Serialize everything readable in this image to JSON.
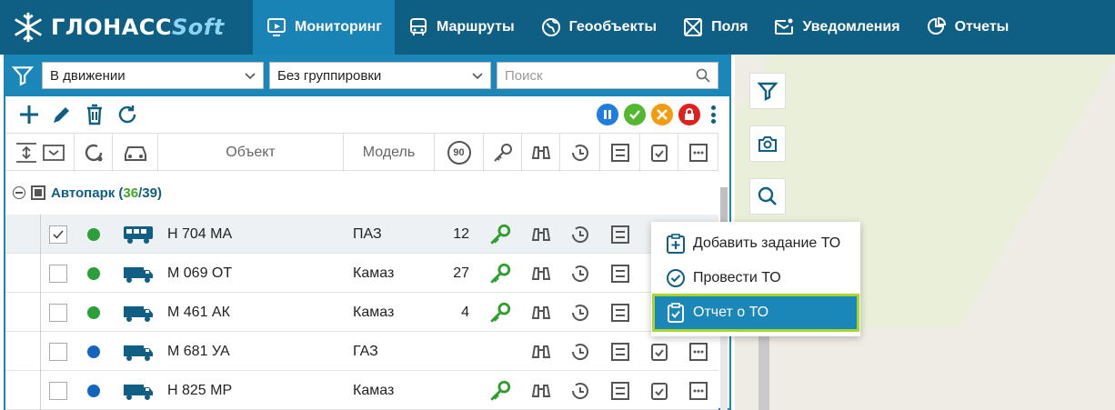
{
  "brand": {
    "name_main": "ГЛОНАСС",
    "name_soft": "Soft"
  },
  "nav": {
    "tabs": [
      {
        "label": "Мониторинг",
        "icon": "monitor-icon",
        "active": true
      },
      {
        "label": "Маршруты",
        "icon": "bus-icon"
      },
      {
        "label": "Геообъекты",
        "icon": "globe-icon"
      },
      {
        "label": "Поля",
        "icon": "field-icon"
      },
      {
        "label": "Уведомления",
        "icon": "mail-icon"
      },
      {
        "label": "Отчеты",
        "icon": "report-icon"
      }
    ]
  },
  "filters": {
    "status_value": "В движении",
    "group_value": "Без группировки",
    "search_placeholder": "Поиск"
  },
  "columns": {
    "object": "Объект",
    "model": "Модель",
    "speed_badge": "90"
  },
  "group": {
    "name": "Автопарк",
    "open": "(",
    "count_active": "36",
    "slash": "/",
    "count_total": "39",
    "close": ")"
  },
  "rows": [
    {
      "plate": "Н 704 МА",
      "model": "ПАЗ",
      "speed": "12",
      "dot": "#2c9e3a",
      "vehicle": "bus-icon",
      "checked": true,
      "key": true
    },
    {
      "plate": "М 069 ОТ",
      "model": "Камаз",
      "speed": "27",
      "dot": "#2c9e3a",
      "vehicle": "truck-icon",
      "checked": false,
      "key": true
    },
    {
      "plate": "М 461 АК",
      "model": "Камаз",
      "speed": "4",
      "dot": "#2c9e3a",
      "vehicle": "truck-icon",
      "checked": false,
      "key": true
    },
    {
      "plate": "М 681 УА",
      "model": "ГАЗ",
      "speed": "",
      "dot": "#1565c0",
      "vehicle": "truck-icon",
      "checked": false,
      "key": false
    },
    {
      "plate": "Н 825 МР",
      "model": "Камаз",
      "speed": "",
      "dot": "#1565c0",
      "vehicle": "truck-icon",
      "checked": false,
      "key": true
    }
  ],
  "context_menu": {
    "items": [
      {
        "label": "Добавить задание ТО",
        "icon": "clipboard-plus-icon"
      },
      {
        "label": "Провести ТО",
        "icon": "check-circle-icon"
      },
      {
        "label": "Отчет о ТО",
        "icon": "clipboard-check-icon",
        "highlighted": true
      }
    ]
  },
  "colors": {
    "primary": "#0f5f84",
    "accent": "#1a87b8",
    "green": "#42a829",
    "highlight_border": "#a9d62a"
  }
}
